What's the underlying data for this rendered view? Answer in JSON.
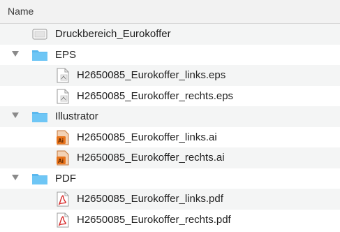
{
  "header": {
    "column_name": "Name"
  },
  "rows": [
    {
      "label": "Druckbereich_Eurokoffer"
    },
    {
      "label": "EPS"
    },
    {
      "label": "H2650085_Eurokoffer_links.eps"
    },
    {
      "label": "H2650085_Eurokoffer_rechts.eps"
    },
    {
      "label": "Illustrator"
    },
    {
      "label": "H2650085_Eurokoffer_links.ai"
    },
    {
      "label": "H2650085_Eurokoffer_rechts.ai"
    },
    {
      "label": "PDF"
    },
    {
      "label": "H2650085_Eurokoffer_links.pdf"
    },
    {
      "label": "H2650085_Eurokoffer_rechts.pdf"
    }
  ],
  "icons": {
    "folder": "folder-icon",
    "eps": "eps-file-icon",
    "ai": "illustrator-file-icon",
    "pdf": "pdf-file-icon",
    "doc": "document-icon",
    "disclosure": "disclosure-triangle-icon"
  },
  "colors": {
    "folder": "#5ab8ee",
    "ai": "#e8731a",
    "pdf": "#d62828",
    "alt_row": "#f4f5f5"
  }
}
